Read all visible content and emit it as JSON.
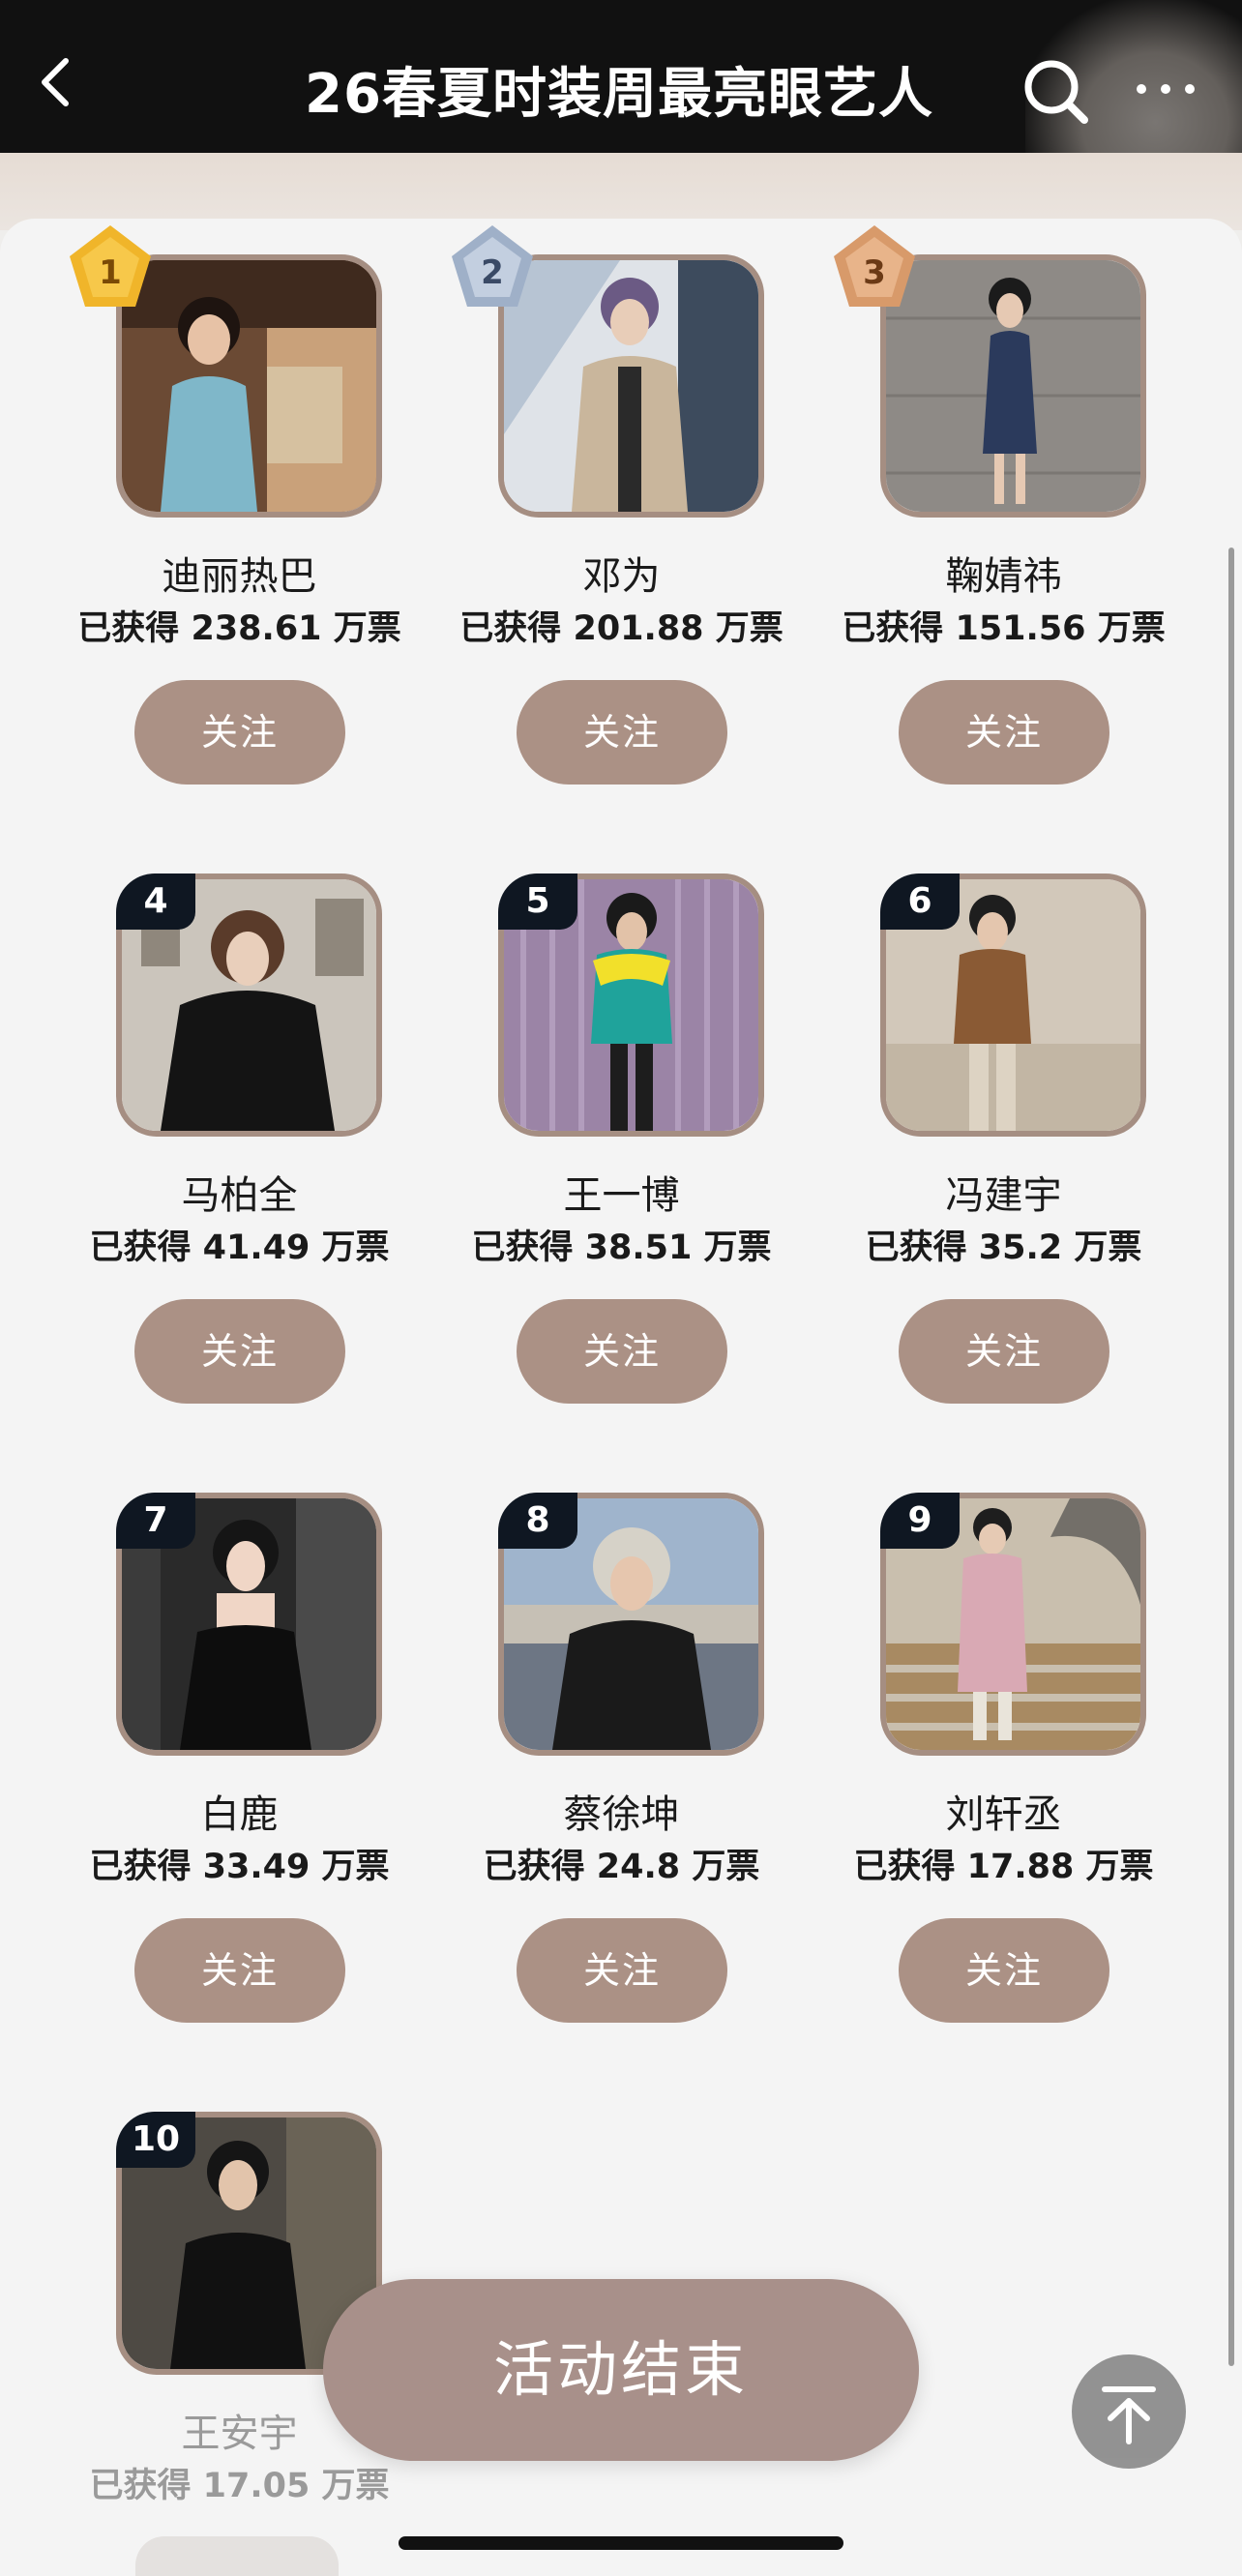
{
  "header": {
    "title": "26春夏时装周最亮眼艺人",
    "back_icon": "chevron-left-icon",
    "search_icon": "search-icon",
    "more_icon": "more-icon"
  },
  "accent_color": "#ab9185",
  "ranking": [
    {
      "rank": "1",
      "name": "迪丽热巴",
      "votes": "已获得 238.61 万票",
      "follow": "关注"
    },
    {
      "rank": "2",
      "name": "邓为",
      "votes": "已获得 201.88 万票",
      "follow": "关注"
    },
    {
      "rank": "3",
      "name": "鞠婧祎",
      "votes": "已获得 151.56 万票",
      "follow": "关注"
    },
    {
      "rank": "4",
      "name": "马柏全",
      "votes": "已获得 41.49 万票",
      "follow": "关注"
    },
    {
      "rank": "5",
      "name": "王一博",
      "votes": "已获得 38.51 万票",
      "follow": "关注"
    },
    {
      "rank": "6",
      "name": "冯建宇",
      "votes": "已获得 35.2 万票",
      "follow": "关注"
    },
    {
      "rank": "7",
      "name": "白鹿",
      "votes": "已获得 33.49 万票",
      "follow": "关注"
    },
    {
      "rank": "8",
      "name": "蔡徐坤",
      "votes": "已获得 24.8 万票",
      "follow": "关注"
    },
    {
      "rank": "9",
      "name": "刘轩丞",
      "votes": "已获得 17.88 万票",
      "follow": "关注"
    },
    {
      "rank": "10",
      "name": "王安宇",
      "votes": "已获得 17.05 万票",
      "follow": ""
    }
  ],
  "footer": {
    "end_button": "活动结束",
    "back_to_top_icon": "arrow-up-to-top-icon"
  }
}
